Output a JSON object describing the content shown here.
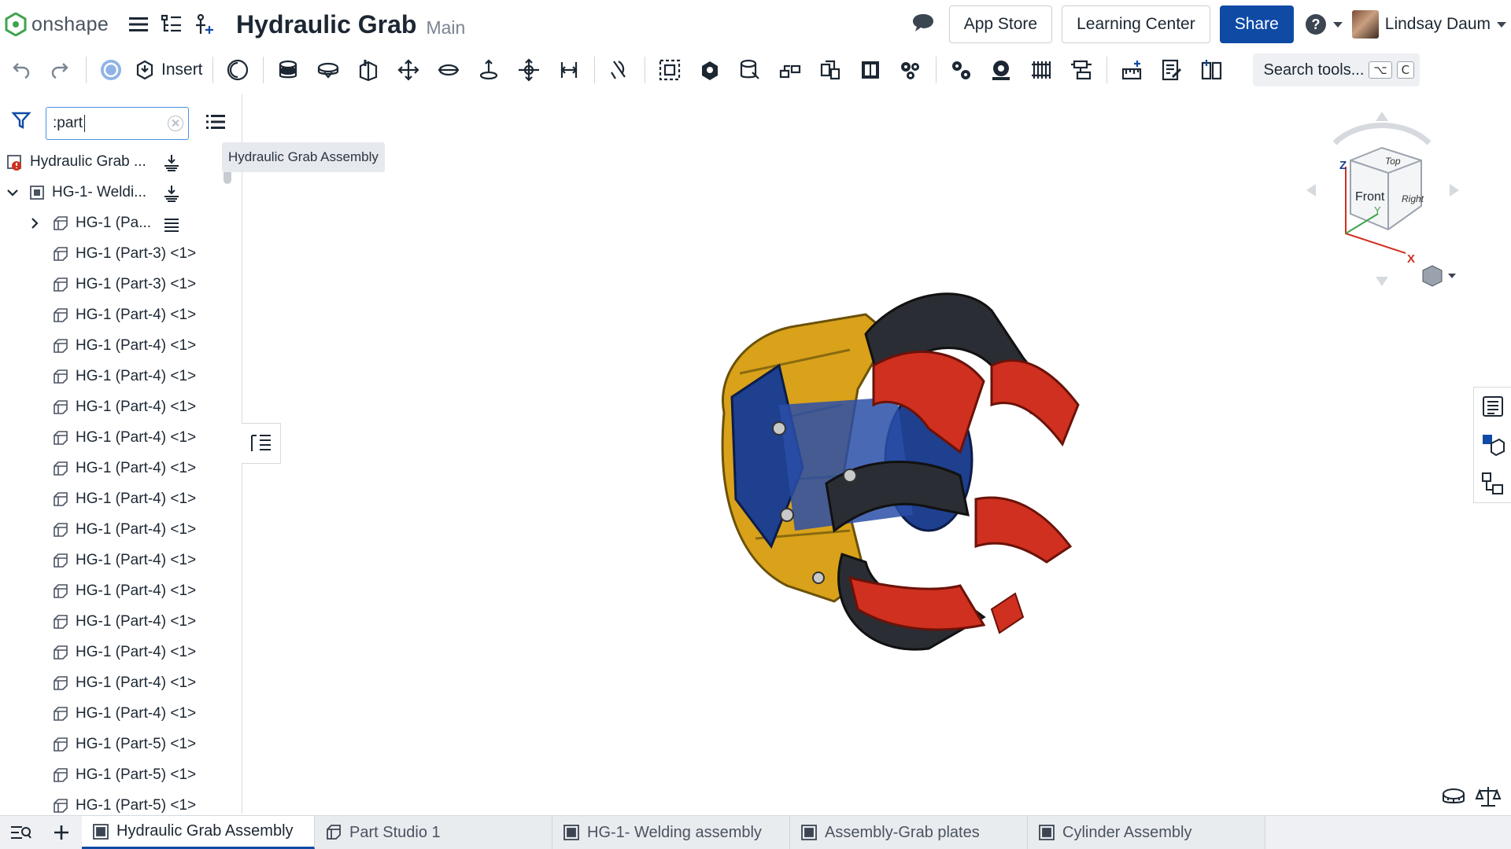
{
  "app": {
    "logo_text": "onshape"
  },
  "document": {
    "title": "Hydraulic Grab",
    "branch": "Main"
  },
  "header": {
    "app_store_label": "App Store",
    "learning_center_label": "Learning Center",
    "share_label": "Share",
    "user_name": "Lindsay Daum"
  },
  "toolbar": {
    "insert_label": "Insert",
    "search_tools_label": "Search tools...",
    "search_tools_keys": [
      "⌥",
      "C"
    ]
  },
  "filter": {
    "value": ":part"
  },
  "tree": {
    "root_label": "Hydraulic Grab ...",
    "tooltip": "Hydraulic Grab Assembly",
    "subassembly_label": "HG-1- Weldi...",
    "pattern_label": "HG-1 (Pa...",
    "parts": [
      "HG-1 (Part-3) <1>",
      "HG-1 (Part-3) <1>",
      "HG-1 (Part-4) <1>",
      "HG-1 (Part-4) <1>",
      "HG-1 (Part-4) <1>",
      "HG-1 (Part-4) <1>",
      "HG-1 (Part-4) <1>",
      "HG-1 (Part-4) <1>",
      "HG-1 (Part-4) <1>",
      "HG-1 (Part-4) <1>",
      "HG-1 (Part-4) <1>",
      "HG-1 (Part-4) <1>",
      "HG-1 (Part-4) <1>",
      "HG-1 (Part-4) <1>",
      "HG-1 (Part-4) <1>",
      "HG-1 (Part-4) <1>",
      "HG-1 (Part-5) <1>",
      "HG-1 (Part-5) <1>",
      "HG-1 (Part-5) <1>"
    ]
  },
  "viewcube": {
    "top": "Top",
    "front": "Front",
    "right": "Right",
    "axis_x": "X",
    "axis_y": "Y",
    "axis_z": "Z"
  },
  "tabs": [
    {
      "label": "Hydraulic Grab Assembly",
      "active": true,
      "icon": "assembly-icon"
    },
    {
      "label": "Part Studio 1",
      "active": false,
      "icon": "part-studio-icon"
    },
    {
      "label": "HG-1- Welding assembly",
      "active": false,
      "icon": "assembly-icon"
    },
    {
      "label": "Assembly-Grab plates",
      "active": false,
      "icon": "assembly-icon"
    },
    {
      "label": "Cylinder Assembly",
      "active": false,
      "icon": "assembly-icon"
    }
  ],
  "colors": {
    "accent": "#0f4aa5",
    "logo_green": "#3fa34d",
    "model_red": "#d0301f",
    "model_dark": "#2a2d33",
    "model_gold": "#d9a21a",
    "model_blue": "#1f3f8f"
  }
}
